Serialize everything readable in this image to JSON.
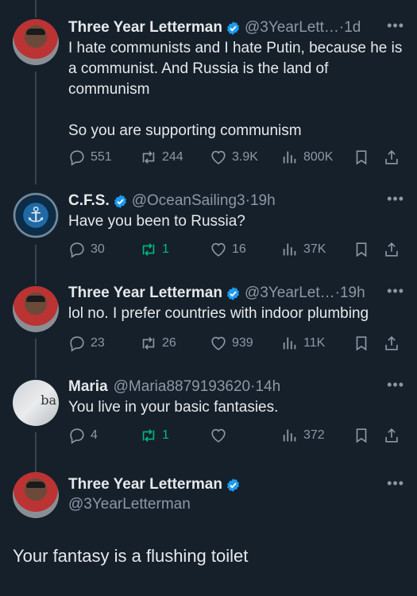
{
  "tweets": [
    {
      "name": "Three Year Letterman",
      "handle": "@3YearLett…",
      "time": "1d",
      "text": "I hate communists and I hate Putin, because he is a communist. And Russia is the land of communism\n\nSo you are supporting communism",
      "replies": "551",
      "retweets": "244",
      "likes": "3.9K",
      "views": "800K"
    },
    {
      "name": "C.F.S.",
      "handle": "@OceanSailing3",
      "time": "19h",
      "text": "Have you been to Russia?",
      "replies": "30",
      "retweets": "1",
      "likes": "16",
      "views": "37K"
    },
    {
      "name": "Three Year Letterman",
      "handle": "@3YearLet…",
      "time": "19h",
      "text": "lol no. I prefer countries with indoor plumbing",
      "replies": "23",
      "retweets": "26",
      "likes": "939",
      "views": "11K"
    },
    {
      "name": "Maria",
      "handle": "@Maria8879193620",
      "time": "14h",
      "text": "You live in your basic fantasies.",
      "replies": "4",
      "retweets": "1",
      "likes": "",
      "views": "372"
    }
  ],
  "main": {
    "name": "Three Year Letterman",
    "handle": "@3YearLetterman",
    "text": "Your fantasy is a flushing toilet"
  },
  "separator": "·",
  "more_glyph": "•••",
  "colors": {
    "background": "#15202b",
    "verified": "#1d9bf0",
    "retweeted": "#00ba7c",
    "muted": "#8b98a5"
  }
}
